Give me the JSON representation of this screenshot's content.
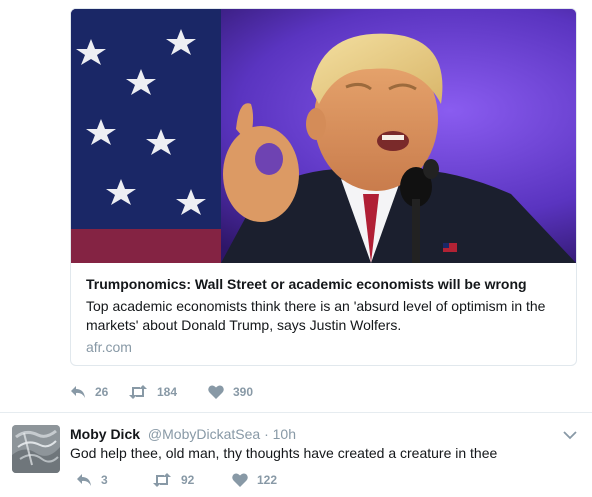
{
  "tweet_1": {
    "card": {
      "image_alt": "Trump speaking at podium",
      "title": "Trumponomics: Wall Street or academic economists will be wrong",
      "description": "Top academic economists think there is an 'absurd level of optimism in the markets' about Donald Trump, says Justin Wolfers.",
      "domain": "afr.com"
    },
    "actions": {
      "reply_count": "26",
      "retweet_count": "184",
      "like_count": "390"
    }
  },
  "tweet_2": {
    "author_name": "Moby Dick",
    "author_handle": "@MobyDickatSea",
    "separator": "·",
    "timestamp": "10h",
    "text": "God help thee, old man, thy thoughts have created a creature in thee",
    "actions": {
      "reply_count": "3",
      "retweet_count": "92",
      "like_count": "122"
    }
  },
  "colors": {
    "text_primary": "#14171a",
    "text_secondary": "#8899a6",
    "border": "#e1e8ed"
  },
  "icons": [
    "reply-icon",
    "retweet-icon",
    "heart-icon",
    "chevron-down-icon"
  ]
}
